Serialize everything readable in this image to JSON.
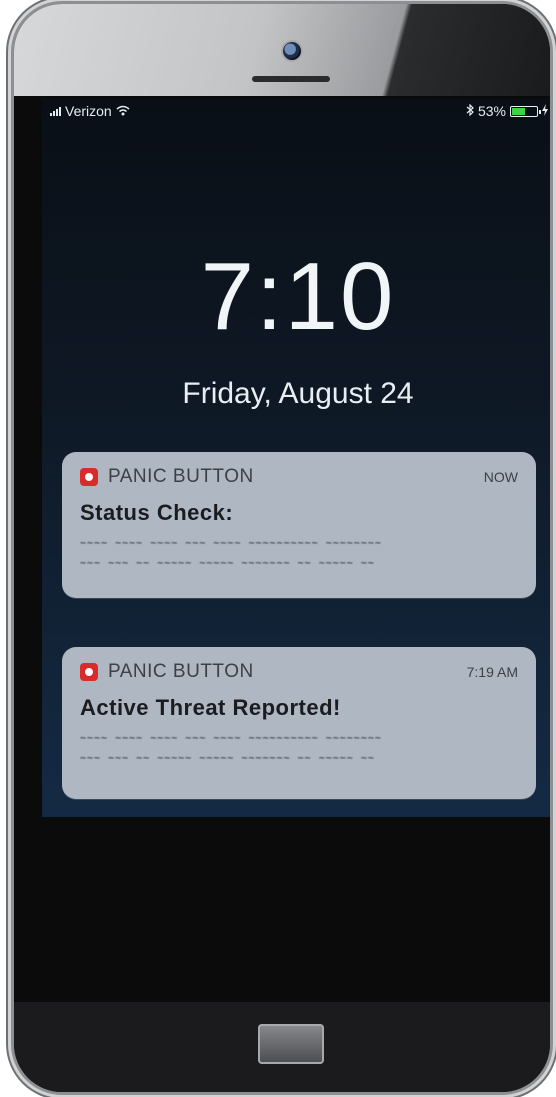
{
  "status_bar": {
    "carrier": "Verizon",
    "battery_percent": "53%",
    "battery_level": 0.53,
    "icons": [
      "signal-icon",
      "wifi-icon",
      "bluetooth-icon",
      "battery-icon",
      "charging-icon"
    ]
  },
  "lock_screen": {
    "time": "7:10",
    "date": "Friday, August 24"
  },
  "notifications": [
    {
      "app": "PANIC BUTTON",
      "time": "NOW",
      "title": "Status Check:",
      "body_line1": "~~~~ ~~~~ ~~~~ ~~~ ~~~~ ~~~~~~~~~~ ~~~~~~~~",
      "body_line2": "~~~ ~~~ ~~ ~~~~~ ~~~~~ ~~~~~~~ ~~ ~~~~~ ~~"
    },
    {
      "app": "PANIC BUTTON",
      "time": "7:19 AM",
      "title": "Active Threat Reported!",
      "body_line1": "~~~~ ~~~~ ~~~~ ~~~ ~~~~ ~~~~~~~~~~ ~~~~~~~~",
      "body_line2": "~~~ ~~~ ~~ ~~~~~ ~~~~~ ~~~~~~~ ~~ ~~~~~ ~~"
    }
  ],
  "colors": {
    "app_icon": "#d92b2b",
    "battery_fill": "#3fd14a",
    "notification_bg": "#aeb7c2"
  }
}
